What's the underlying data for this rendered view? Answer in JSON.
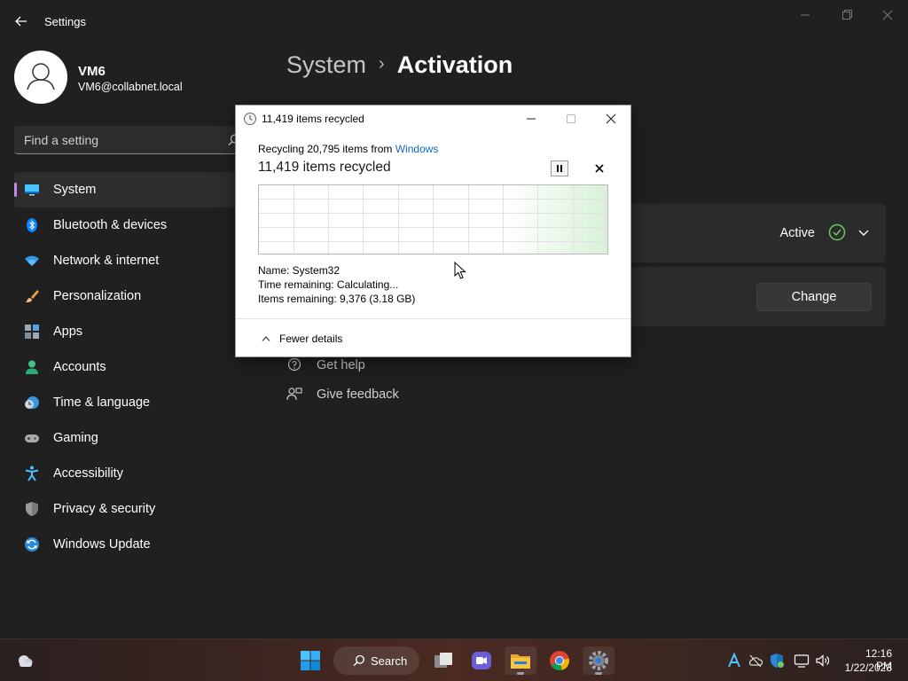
{
  "app": {
    "title": "Settings"
  },
  "profile": {
    "name": "VM6",
    "email": "VM6@collabnet.local"
  },
  "search": {
    "placeholder": "Find a setting"
  },
  "nav": {
    "items": [
      {
        "label": "System",
        "icon": "monitor-icon",
        "selected": true
      },
      {
        "label": "Bluetooth & devices",
        "icon": "bluetooth-icon"
      },
      {
        "label": "Network & internet",
        "icon": "wifi-icon"
      },
      {
        "label": "Personalization",
        "icon": "brush-icon"
      },
      {
        "label": "Apps",
        "icon": "apps-icon"
      },
      {
        "label": "Accounts",
        "icon": "person-icon"
      },
      {
        "label": "Time & language",
        "icon": "clock-globe-icon"
      },
      {
        "label": "Gaming",
        "icon": "gamepad-icon"
      },
      {
        "label": "Accessibility",
        "icon": "accessibility-icon"
      },
      {
        "label": "Privacy & security",
        "icon": "shield-icon"
      },
      {
        "label": "Windows Update",
        "icon": "update-icon"
      }
    ]
  },
  "breadcrumb": {
    "parent": "System",
    "separator": "›",
    "current": "Activation"
  },
  "activation": {
    "status": "Active",
    "change_label": "Change"
  },
  "links": {
    "help": "Get help",
    "feedback": "Give feedback"
  },
  "dialog": {
    "title": "11,419 items recycled",
    "subtitle_prefix": "Recycling 20,795 items from ",
    "subtitle_location": "Windows",
    "heading": "11,419 items recycled",
    "name_line": "Name:  System32",
    "time_line": "Time remaining:  Calculating...",
    "items_line": "Items remaining:  9,376 (3.18 GB)",
    "fewer_details": "Fewer details"
  },
  "taskbar": {
    "search_label": "Search",
    "apps": [
      "start-icon",
      "search",
      "task-view-icon",
      "chat-icon",
      "file-explorer-icon",
      "chrome-icon",
      "settings-icon"
    ],
    "tray": [
      "font-icon",
      "cloud-off-icon",
      "defender-icon",
      "display-icon",
      "volume-icon"
    ],
    "time": "12:16 PM",
    "date": "1/22/2023"
  },
  "colors": {
    "accent": "#c587e8",
    "link": "#0f6cbd",
    "success": "#6ccb5f"
  }
}
